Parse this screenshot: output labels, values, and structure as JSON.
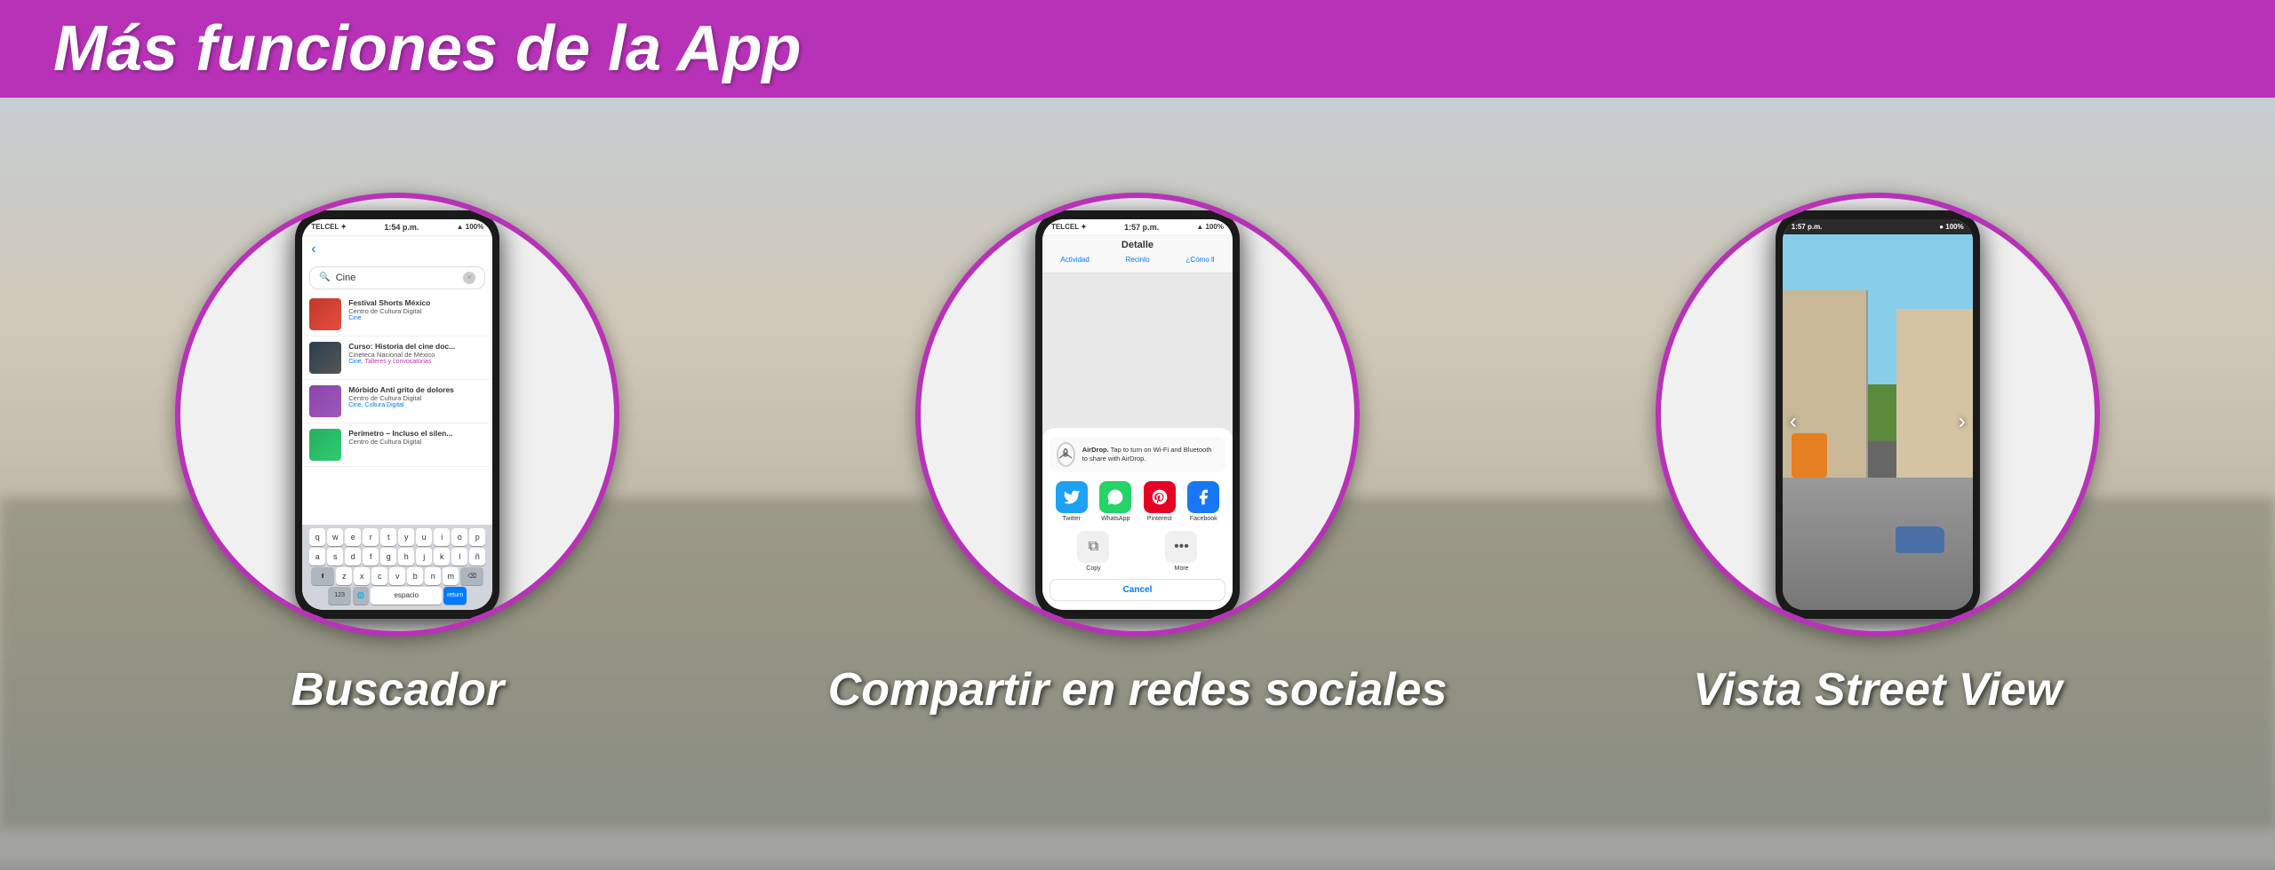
{
  "header": {
    "title": "Más funciones de la App",
    "bg_color": "#b832b8"
  },
  "sections": [
    {
      "id": "buscador",
      "label": "Buscador",
      "phone": {
        "status": {
          "carrier": "TELCEL",
          "time": "1:54 p.m.",
          "battery": "100%"
        },
        "search": {
          "query": "Cine",
          "placeholder": "Cine"
        },
        "results": [
          {
            "title": "Festival Shorts México",
            "sub": "Centro de Cultura Digital",
            "tag": "Cine"
          },
          {
            "title": "Curso: Historia del cine doc...",
            "sub": "Cineteca Nacional de México",
            "tag": "Cine,",
            "tag2": "Talleres y convocatorias"
          },
          {
            "title": "Mórbido Anti grito de dolores",
            "sub": "Centro de Cultura Digital",
            "tag": "Cine, Cultura Digital"
          },
          {
            "title": "Perímetro – Incluso el silen...",
            "sub": "Centro de Cultura Digital",
            "tag": ""
          }
        ],
        "keyboard": {
          "rows": [
            [
              "q",
              "w",
              "e",
              "r",
              "t",
              "y",
              "u",
              "i",
              "o",
              "p"
            ],
            [
              "a",
              "s",
              "d",
              "f",
              "g",
              "h",
              "j",
              "k",
              "l",
              "ñ"
            ],
            [
              "z",
              "x",
              "c",
              "v",
              "b",
              "n",
              "m"
            ]
          ],
          "space_label": "espacio"
        }
      }
    },
    {
      "id": "compartir",
      "label": "Compartir en redes sociales",
      "phone": {
        "status": {
          "carrier": "TELCEL",
          "time": "1:57 p.m.",
          "battery": "100%"
        },
        "detail_title": "Detalle",
        "tabs": [
          "Actividad",
          "Recinto",
          "¿Cómo ll"
        ],
        "share_sheet": {
          "airdrop_title": "AirDrop.",
          "airdrop_text": "Tap to turn on Wi-Fi and Bluetooth to share with AirDrop.",
          "apps": [
            {
              "label": "Twitter",
              "icon": "twitter"
            },
            {
              "label": "WhatsApp",
              "icon": "whatsapp"
            },
            {
              "label": "Pinterest",
              "icon": "pinterest"
            },
            {
              "label": "Facebook",
              "icon": "facebook"
            }
          ],
          "copy_label": "Copy",
          "more_label": "More",
          "cancel_label": "Cancel"
        }
      }
    },
    {
      "id": "streetview",
      "label": "Vista Street View",
      "phone": {
        "status": {
          "time": "1:57 p.m.",
          "battery": "100%"
        },
        "nav_left": "‹",
        "nav_right": "›"
      }
    }
  ]
}
